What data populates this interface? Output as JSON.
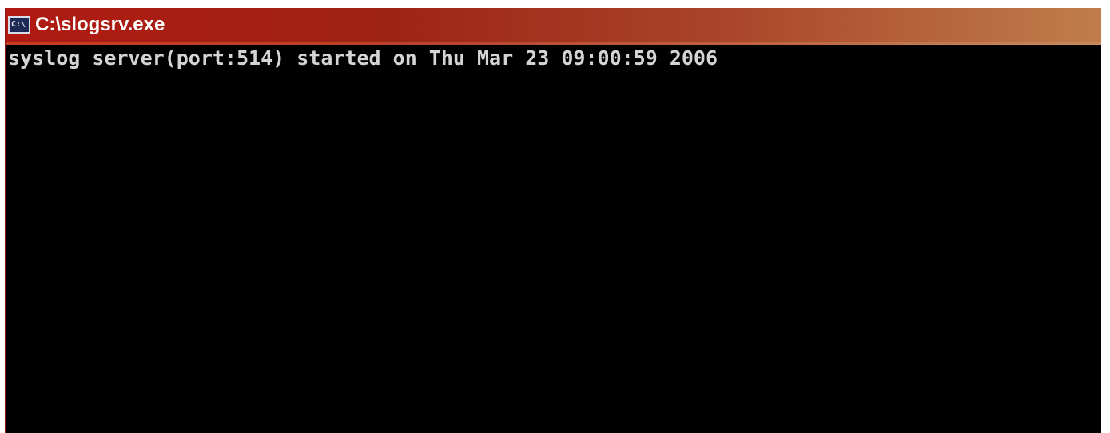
{
  "window": {
    "title": "C:\\slogsrv.exe",
    "icon": "console-icon",
    "icon_glyph": "C:\\"
  },
  "console": {
    "lines": [
      "syslog server(port:514) started on Thu Mar 23 09:00:59 2006"
    ]
  },
  "colors": {
    "titlebar_start": "#b01a12",
    "titlebar_end": "#c07d4c",
    "console_bg": "#000000",
    "console_text": "#d4d4d4"
  }
}
